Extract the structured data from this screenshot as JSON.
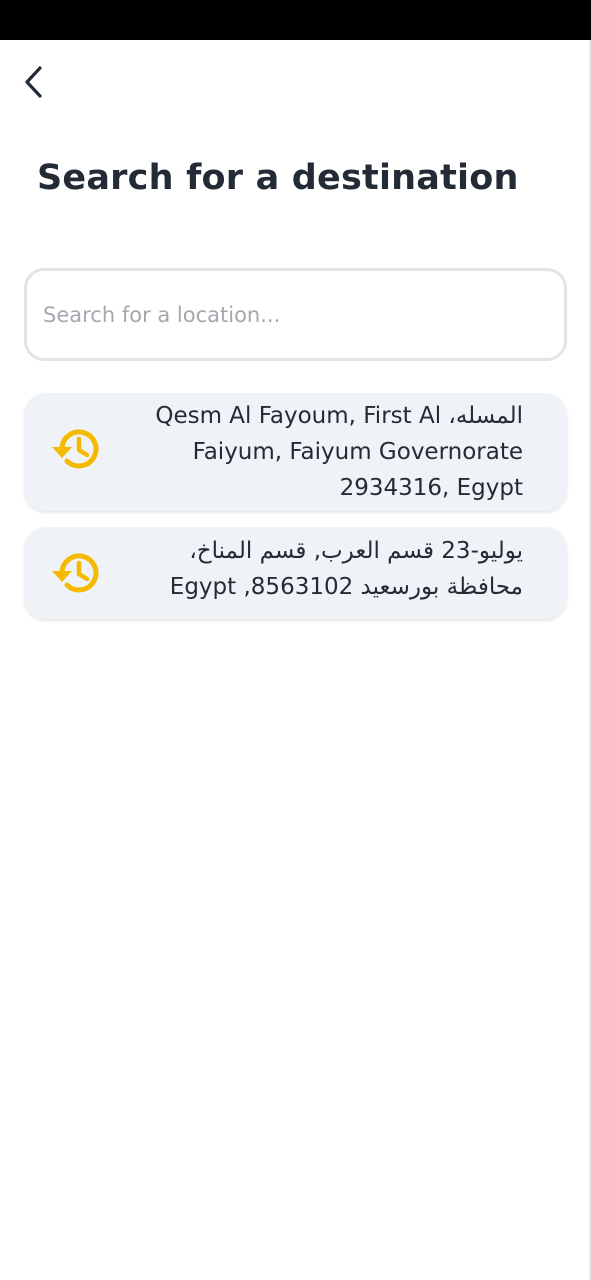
{
  "header": {
    "back_icon": "chevron-left-icon",
    "title": "Search for a destination"
  },
  "search": {
    "placeholder": "Search for a location...",
    "value": ""
  },
  "recent_locations": [
    {
      "icon": "history-icon",
      "address": "المسله، Qesm Al Fayoum, First Al Faiyum, Faiyum Governorate 2934316, Egypt"
    },
    {
      "icon": "history-icon",
      "address": "يوليو-23 قسم العرب, قسم المناخ، محافظة بورسعيد 8563102, Egypt"
    }
  ],
  "colors": {
    "accent": "#f5b900",
    "title": "#232b37",
    "card_background": "#eff3f7",
    "input_border": "#e2e4e8",
    "placeholder": "#a4a8af",
    "status_bar": "#000000"
  }
}
